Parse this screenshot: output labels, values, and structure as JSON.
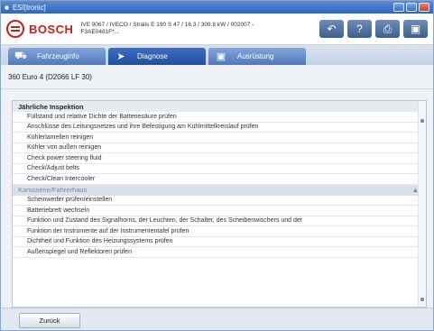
{
  "titlebar": {
    "title": "ESI[tronic]"
  },
  "header": {
    "brand": "BOSCH",
    "vehicle": "IVE 9067 / IVECO / Stralis E 190 S 47 / 16.3 / 309.8 kW / 002007 - F3AE0481F*..."
  },
  "tabs": [
    {
      "label": "Fahrzeuginfo",
      "icon": "car-icon"
    },
    {
      "label": "Diagnose",
      "icon": "diagnose-icon"
    },
    {
      "label": "Ausrüstung",
      "icon": "book-icon"
    }
  ],
  "vehicle_code": "360 Euro 4 (D2066 LF 30)",
  "list": {
    "section1": "Jährliche Inspektion",
    "rows1": [
      "Füllstand und relative Dichte der Batteriesäure prüfen",
      "Anschlüsse des Leitungsnetzes und ihre Befestigung am Kühlmittelkreislauf prüfen",
      "Kühlerlamellen reinigen",
      "Kühler von außen reinigen",
      "Check power steering fluid",
      "Check/Adjust belts",
      "Check/Clean Intercooler"
    ],
    "section2": "Karosserie/Fahrerhaus",
    "rows2": [
      "Scheinwerfer prüfen/einstellen",
      "Batteriebrett wechseln",
      "Funktion und Zustand des Signalhorns, der Leuchten, der Schalter, des Scheibenwischers und der",
      "Funktion der Instrumente auf der Instrumententafel prüfen",
      "Dichtheit und Funktion des Heizungssystems prüfen",
      "Außenspiegel und Reflektoren prüfen"
    ]
  },
  "footer": {
    "back_label": "Zurück"
  }
}
